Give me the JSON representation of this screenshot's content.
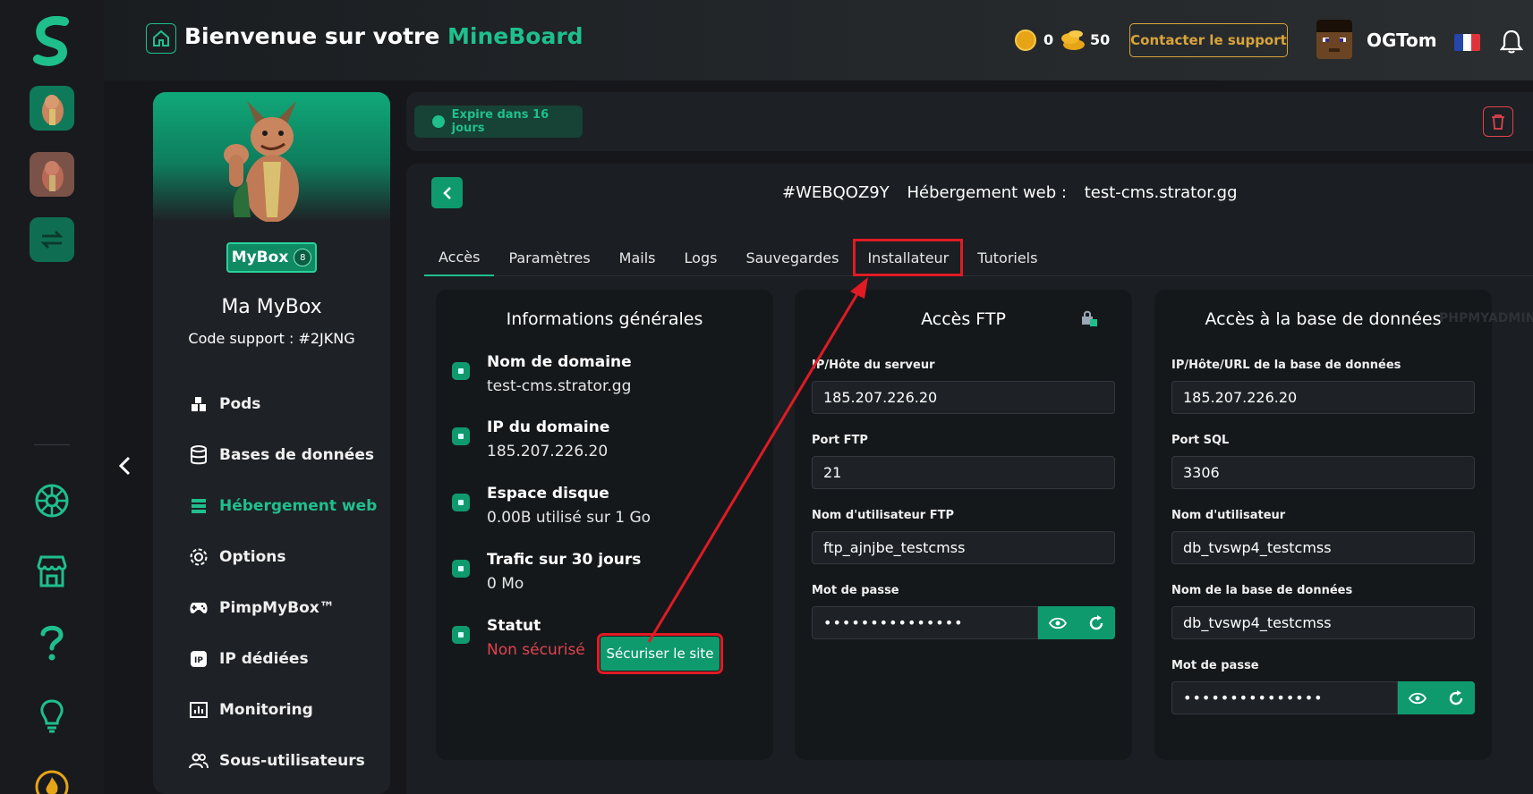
{
  "header": {
    "welcome_prefix": "Bienvenue sur votre",
    "welcome_brand": "MineBoard",
    "coins_a": "0",
    "coins_b": "50",
    "support_label": "Contacter le support",
    "username": "OGTom"
  },
  "profile": {
    "badge_label": "MyBox",
    "badge_level": "8",
    "name": "Ma MyBox",
    "support_code": "Code support : #2JKNG",
    "menu": [
      {
        "label": "Pods",
        "icon": "blocks-icon"
      },
      {
        "label": "Bases de données",
        "icon": "database-icon"
      },
      {
        "label": "Hébergement web",
        "icon": "server-icon"
      },
      {
        "label": "Options",
        "icon": "gear-icon"
      },
      {
        "label": "PimpMyBox™",
        "icon": "gamepad-icon"
      },
      {
        "label": "IP dédiées",
        "icon": "ip-icon"
      },
      {
        "label": "Monitoring",
        "icon": "chart-icon"
      },
      {
        "label": "Sous-utilisateurs",
        "icon": "users-icon"
      }
    ]
  },
  "topbar": {
    "expire_label": "Expire dans 16 jours"
  },
  "service": {
    "id": "#WEBQOZ9Y",
    "type": "Hébergement web :",
    "domain": "test-cms.strator.gg"
  },
  "tabs": [
    "Accès",
    "Paramètres",
    "Mails",
    "Logs",
    "Sauvegardes",
    "Installateur",
    "Tutoriels"
  ],
  "general": {
    "title": "Informations générales",
    "rows": [
      {
        "label": "Nom de domaine",
        "value": "test-cms.strator.gg"
      },
      {
        "label": "IP du domaine",
        "value": "185.207.226.20"
      },
      {
        "label": "Espace disque",
        "value": "0.00B utilisé sur 1 Go"
      },
      {
        "label": "Trafic sur 30 jours",
        "value": "0 Mo"
      },
      {
        "label": "Statut",
        "value": "Non sécurisé"
      }
    ],
    "secure_label": "Sécuriser le site"
  },
  "ftp": {
    "title": "Accès FTP",
    "fields": [
      {
        "label": "IP/Hôte du serveur",
        "value": "185.207.226.20"
      },
      {
        "label": "Port FTP",
        "value": "21"
      },
      {
        "label": "Nom d'utilisateur FTP",
        "value": "ftp_ajnjbe_testcmss"
      }
    ],
    "password_label": "Mot de passe",
    "password_value": "•••••••••••••••"
  },
  "db": {
    "title": "Accès à la base de données",
    "phpmyadmin": "PHPMYADMIN",
    "fields": [
      {
        "label": "IP/Hôte/URL de la base de données",
        "value": "185.207.226.20"
      },
      {
        "label": "Port SQL",
        "value": "3306"
      },
      {
        "label": "Nom d'utilisateur",
        "value": "db_tvswp4_testcmss"
      },
      {
        "label": "Nom de la base de données",
        "value": "db_tvswp4_testcmss"
      }
    ],
    "password_label": "Mot de passe",
    "password_value": "•••••••••••••••"
  },
  "colors": {
    "accent": "#1fbf8c",
    "danger": "#e0434e",
    "gold": "#d9a43a",
    "highlight": "#e01b24"
  }
}
